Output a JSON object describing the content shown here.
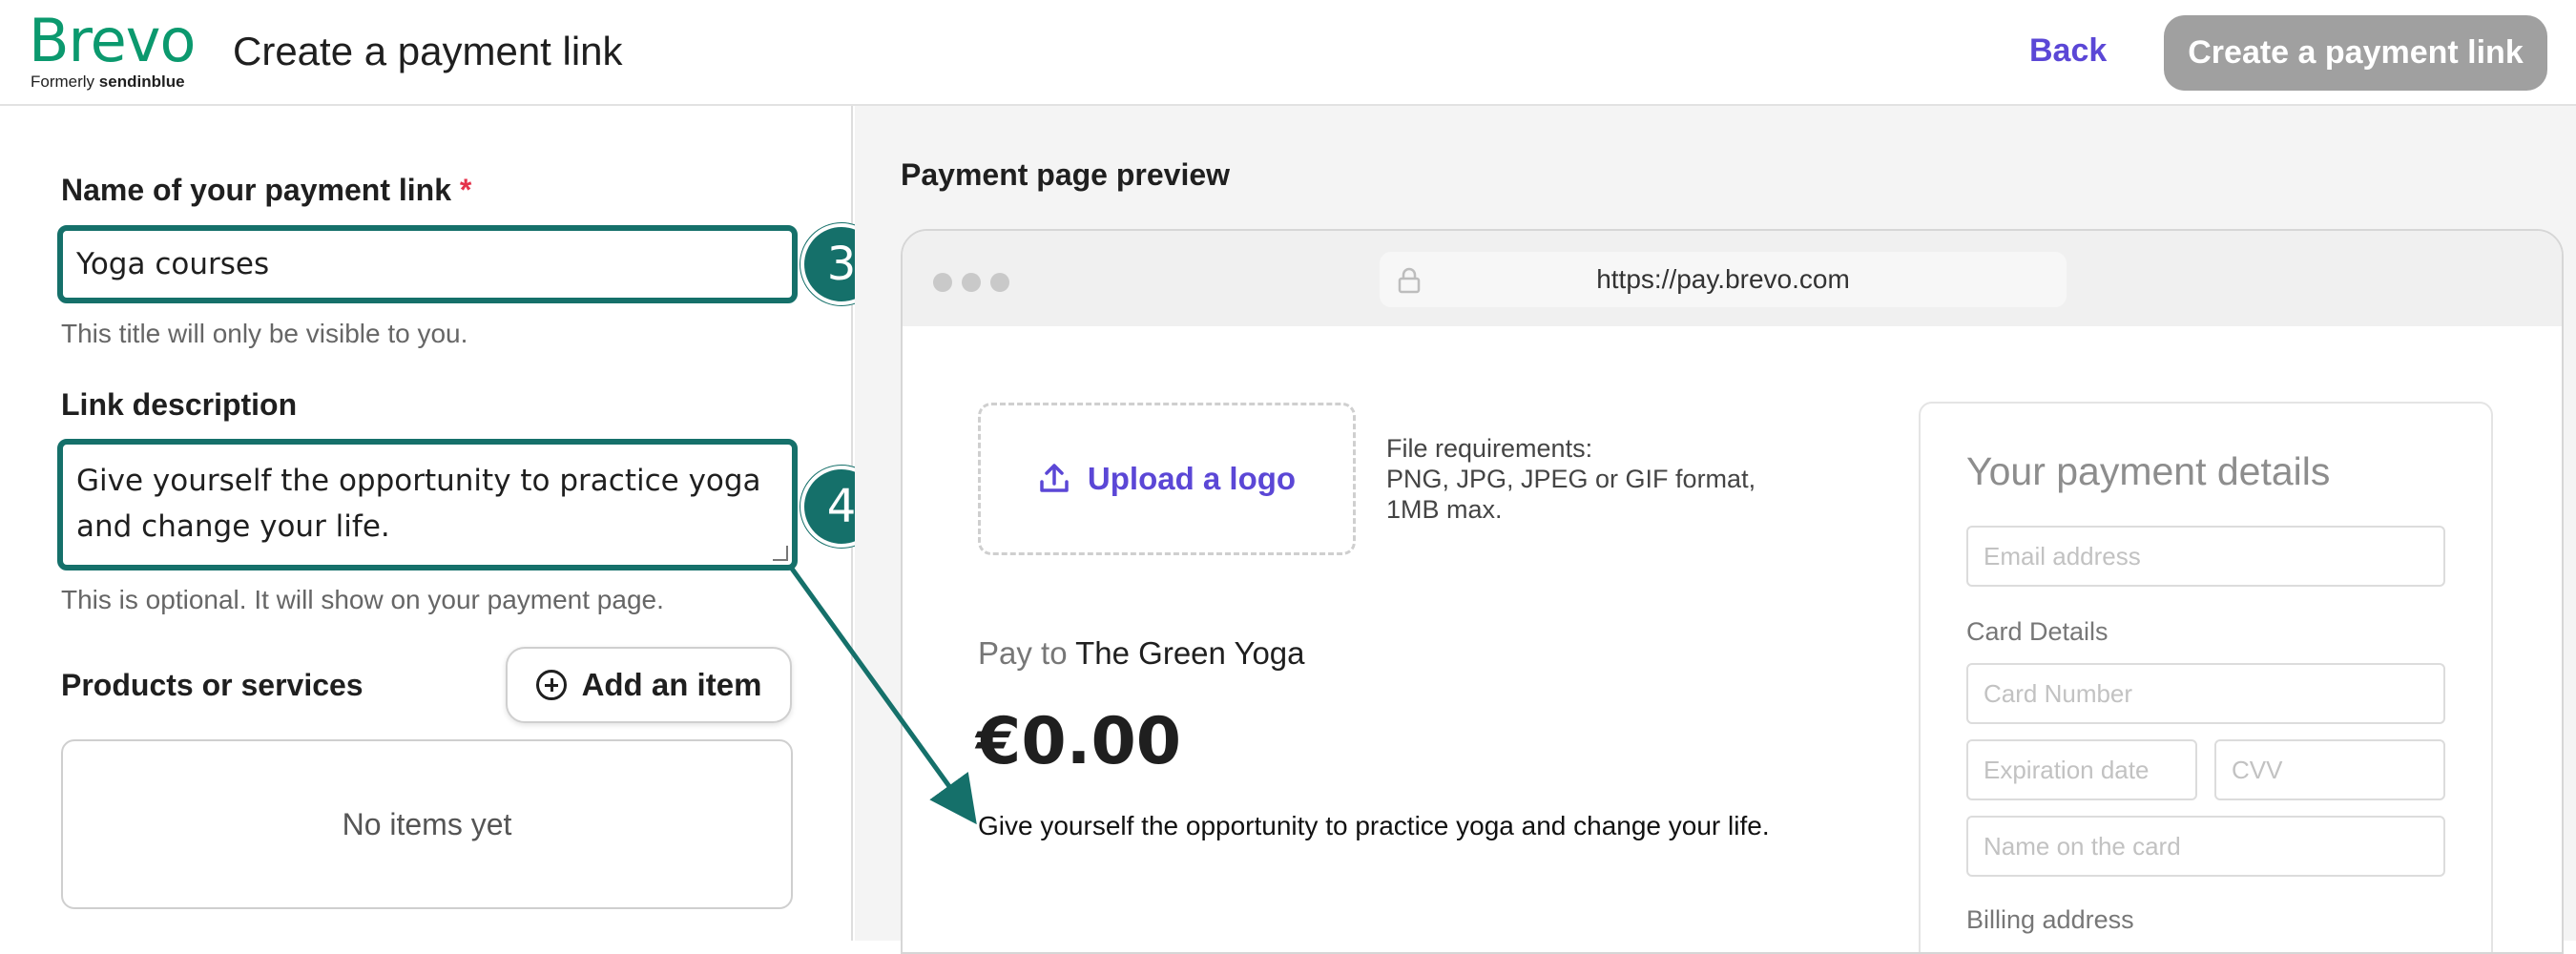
{
  "header": {
    "brand": "Brevo",
    "brand_formerly": "Formerly",
    "brand_former_name": "sendinblue",
    "title": "Create a payment link",
    "back_label": "Back",
    "create_label": "Create a payment link",
    "create_button_color": "#a0a0a0",
    "brand_color": "#0b996e"
  },
  "form": {
    "name_label": "Name of your payment link",
    "required_mark": "*",
    "name_value": "Yoga courses",
    "name_helper": "This title will only be visible to you.",
    "description_label": "Link description",
    "description_value": "Give yourself the opportunity to practice yoga and change your life.",
    "description_helper": "This is optional. It will show on your payment page.",
    "products_label": "Products or services",
    "add_item_label": "Add an item",
    "empty_items": "No items yet",
    "highlight_color": "#15706a"
  },
  "steps": {
    "name_step": "3",
    "description_step": "4"
  },
  "preview": {
    "title": "Payment page preview",
    "url": "https://pay.brevo.com",
    "upload_label": "Upload a logo",
    "file_requirements": [
      "File requirements:",
      "PNG, JPG, JPEG or GIF format,",
      "1MB max."
    ],
    "pay_to_prefix": "Pay to",
    "merchant": "The Green Yoga",
    "amount": "€0.00",
    "description": "Give yourself the opportunity to practice yoga and change your life.",
    "payment_details": {
      "title": "Your payment details",
      "email_placeholder": "Email address",
      "card_details_label": "Card Details",
      "card_number_placeholder": "Card Number",
      "expiration_placeholder": "Expiration date",
      "cvv_placeholder": "CVV",
      "name_on_card_placeholder": "Name on the card",
      "billing_address_label": "Billing address"
    }
  },
  "icons": {
    "lock": "lock-icon",
    "upload": "upload-icon",
    "add": "plus-circle-icon",
    "arrow": "annotation-arrow"
  }
}
